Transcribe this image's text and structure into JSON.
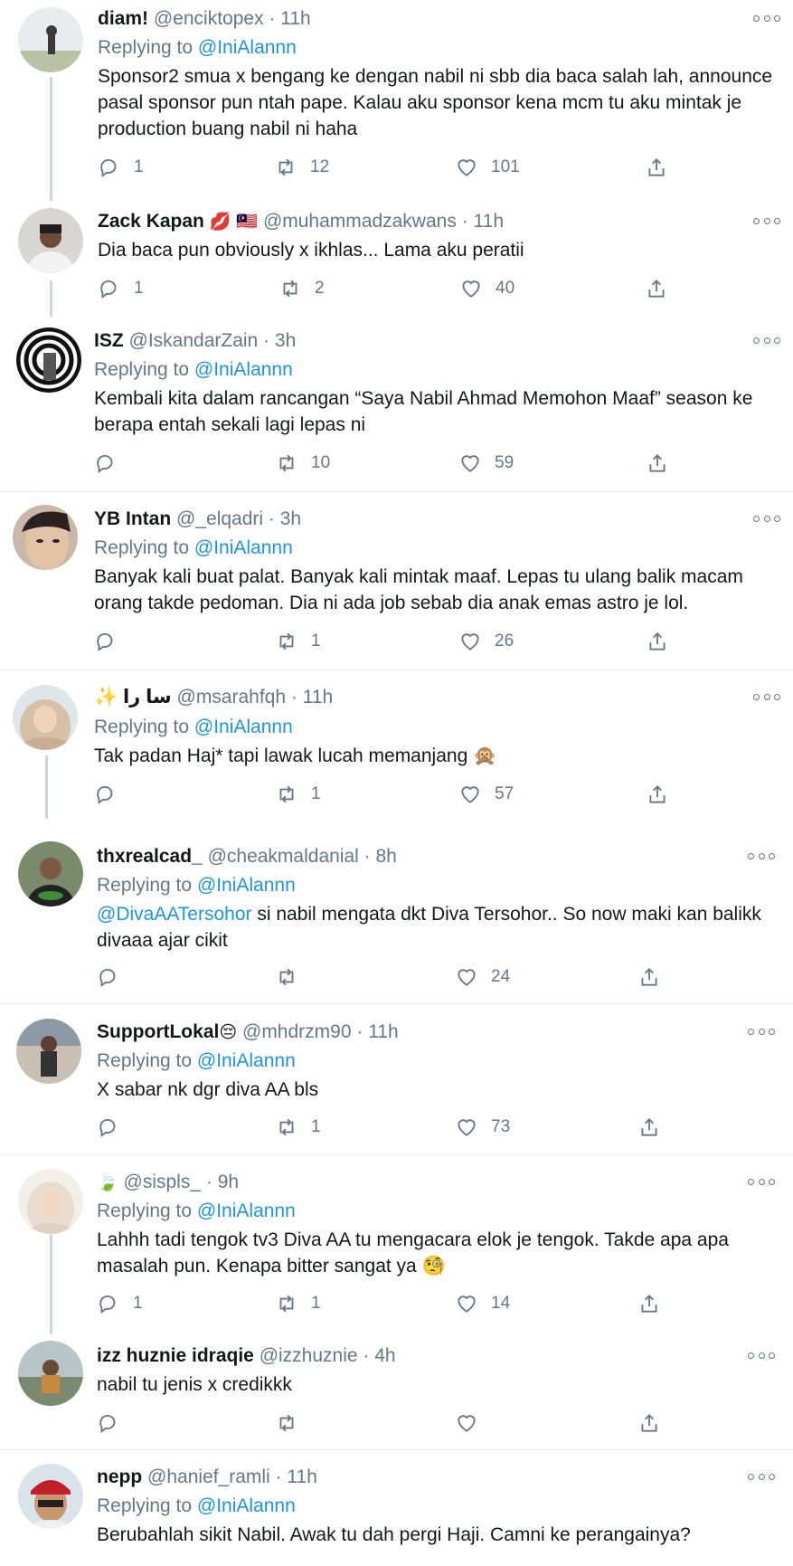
{
  "tweets": [
    {
      "name": "diam!",
      "emoji": "",
      "handle": "@enciktopex",
      "time": "11h",
      "replying_label": "Replying to",
      "replying_to": "@IniAlannn",
      "mention": "",
      "text": "Sponsor2 smua x bengang ke dengan nabil ni sbb dia baca salah lah, announce pasal sponsor pun ntah pape. Kalau aku sponsor kena mcm tu aku mintak je production buang nabil ni haha",
      "replies": "1",
      "retweets": "12",
      "likes": "101"
    },
    {
      "name": "Zack Kapan",
      "emoji": "💋 🇲🇾",
      "handle": "@muhammadzakwans",
      "time": "11h",
      "replying_label": "",
      "replying_to": "",
      "mention": "",
      "text": "Dia baca pun obviously x ikhlas... Lama aku peratii",
      "replies": "1",
      "retweets": "2",
      "likes": "40"
    },
    {
      "name": "ISZ",
      "emoji": "",
      "handle": "@IskandarZain",
      "time": "3h",
      "replying_label": "Replying to",
      "replying_to": "@IniAlannn",
      "mention": "",
      "text": "Kembali kita dalam rancangan “Saya Nabil Ahmad Memohon Maaf” season ke berapa entah sekali lagi lepas ni",
      "replies": "",
      "retweets": "10",
      "likes": "59"
    },
    {
      "name": "YB Intan",
      "emoji": "",
      "handle": "@_elqadri",
      "time": "3h",
      "replying_label": "Replying to",
      "replying_to": "@IniAlannn",
      "mention": "",
      "text": "Banyak kali buat palat. Banyak kali mintak maaf. Lepas tu ulang balik macam orang takde pedoman. Dia ni ada job sebab dia anak emas astro je lol.",
      "replies": "",
      "retweets": "1",
      "likes": "26"
    },
    {
      "name": "✨ سا را",
      "emoji": "",
      "handle": "@msarahfqh",
      "time": "11h",
      "replying_label": "Replying to",
      "replying_to": "@IniAlannn",
      "mention": "",
      "text": "Tak padan Haj* tapi lawak lucah memanjang 🙊",
      "replies": "",
      "retweets": "1",
      "likes": "57"
    },
    {
      "name": "thxrealcad_",
      "emoji": "",
      "handle": "@cheakmaldanial",
      "time": "8h",
      "replying_label": "Replying to",
      "replying_to": "@IniAlannn",
      "mention": "@DivaAATersohor",
      "text": " si nabil mengata dkt Diva Tersohor.. So now maki kan balikk divaaa ajar cikit",
      "replies": "",
      "retweets": "",
      "likes": "24"
    },
    {
      "name": "SupportLokal",
      "emoji": "😔",
      "handle": "@mhdrzm90",
      "time": "11h",
      "replying_label": "Replying to",
      "replying_to": "@IniAlannn",
      "mention": "",
      "text": "X sabar nk dgr diva AA bls",
      "replies": "",
      "retweets": "1",
      "likes": "73"
    },
    {
      "name": "🍃",
      "emoji": "",
      "handle": "@sispls_",
      "time": "9h",
      "replying_label": "Replying to",
      "replying_to": "@IniAlannn",
      "mention": "",
      "text": "Lahhh tadi tengok tv3 Diva AA tu mengacara elok je tengok. Takde apa apa masalah pun. Kenapa bitter sangat ya 🧐",
      "replies": "1",
      "retweets": "1",
      "likes": "14"
    },
    {
      "name": "izz huznie idraqie",
      "emoji": "",
      "handle": "@izzhuznie",
      "time": "4h",
      "replying_label": "",
      "replying_to": "",
      "mention": "",
      "text": "nabil tu jenis x credikkk",
      "replies": "",
      "retweets": "",
      "likes": ""
    },
    {
      "name": "nepp",
      "emoji": "",
      "handle": "@hanief_ramli",
      "time": "11h",
      "replying_label": "Replying to",
      "replying_to": "@IniAlannn",
      "mention": "",
      "text": "Berubahlah sikit Nabil. Awak tu dah pergi Haji. Camni ke perangainya?",
      "replies": "",
      "retweets": "",
      "likes": ""
    }
  ],
  "colors": {
    "text": "#14171a",
    "muted": "#657786",
    "link": "#1b95e0",
    "separator": "#e6ecf0",
    "thread": "#ccd6dd"
  },
  "icons": [
    "reply-icon",
    "retweet-icon",
    "like-icon",
    "share-icon",
    "more-icon"
  ]
}
